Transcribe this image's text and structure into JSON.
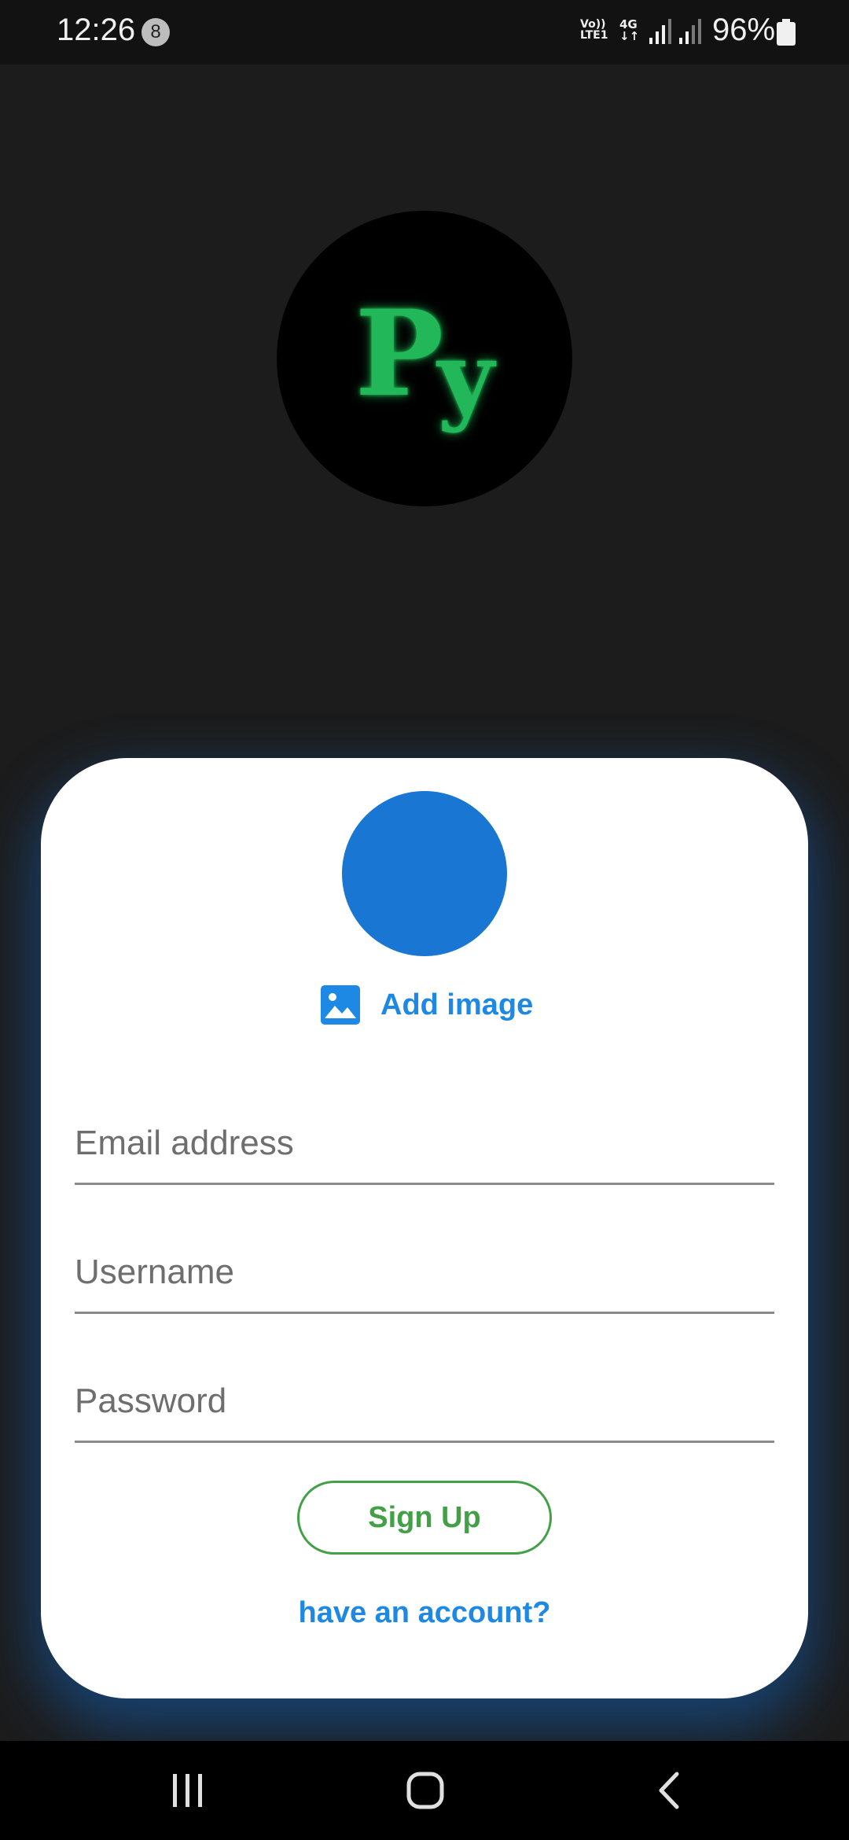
{
  "status_bar": {
    "time": "12:26",
    "notification_count": "8",
    "volte_top": "Vo))",
    "volte_bottom": "LTE1",
    "network_type": "4G",
    "battery_percent": "96%"
  },
  "logo": {
    "letter1": "P",
    "letter2": "y",
    "color": "#22b85a"
  },
  "form": {
    "avatar_color": "#1976d2",
    "add_image_label": "Add image",
    "email_placeholder": "Email address",
    "username_placeholder": "Username",
    "password_placeholder": "Password",
    "signup_label": "Sign Up",
    "have_account_label": "have an account?",
    "accent_blue": "#1e88e5",
    "accent_green": "#43a047"
  },
  "nav_bar": {
    "icons": [
      "recents-icon",
      "home-icon",
      "back-icon"
    ]
  }
}
